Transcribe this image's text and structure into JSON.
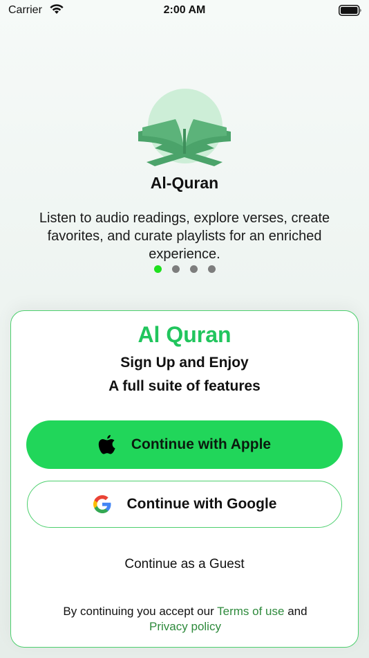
{
  "status_bar": {
    "carrier": "Carrier",
    "time": "2:00 AM"
  },
  "onboarding": {
    "title": "Al-Quran",
    "description": "Listen to audio readings, explore verses, create favorites, and curate playlists for an enriched experience.",
    "page_count": 4,
    "active_page": 1,
    "dot_active_color": "#1fe01f",
    "dot_inactive_color": "#7d7d7d"
  },
  "signup_card": {
    "app_name": "Al Quran",
    "subtitle_line1": "Sign Up and Enjoy",
    "subtitle_line2": "A full suite of features",
    "apple_button_label": "Continue with Apple",
    "google_button_label": "Continue with Google",
    "guest_label": "Continue as a Guest",
    "legal_prefix": "By continuing you accept our",
    "terms_link": "Terms of use",
    "legal_and": "and",
    "privacy_link": "Privacy policy"
  },
  "colors": {
    "accent": "#21d65a",
    "title_green": "#21c55d",
    "link_green": "#2e8a3c",
    "logo_green": "#4ba36a",
    "logo_circle": "#cdeed7"
  },
  "icons": [
    "wifi-icon",
    "battery-icon",
    "quran-book-icon",
    "apple-icon",
    "google-icon"
  ]
}
